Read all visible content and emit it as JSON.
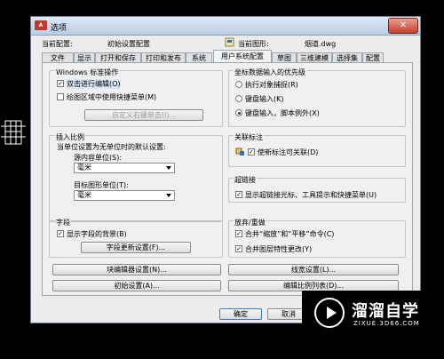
{
  "window": {
    "title": "选项",
    "app_icon_text": "A"
  },
  "header": {
    "current_profile_label": "当前配置:",
    "current_profile_value": "初始设置配置",
    "current_drawing_label": "当前图形:",
    "current_drawing_value": "烟道.dwg"
  },
  "tabs": [
    "文件",
    "显示",
    "打开和保存",
    "打印和发布",
    "系统",
    "用户系统配置",
    "草图",
    "三维建模",
    "选择集",
    "配置"
  ],
  "windows_group": {
    "title": "Windows 标准操作",
    "double_click_edit": "双击进行编辑(O)",
    "shortcut_menu": "绘图区域中使用快捷菜单(M)",
    "custom_right_click": "自定义右键单击(I)..."
  },
  "coord_group": {
    "title": "坐标数据输入的优先级",
    "option1": "执行对象捕捉(R)",
    "option2": "键盘输入(K)",
    "option3": "键盘输入，脚本例外(X)"
  },
  "insert_group": {
    "title": "插入比例",
    "desc": "当单位设置为无单位时的默认设置:",
    "source_label": "源内容单位(S):",
    "source_value": "毫米",
    "target_label": "目标图形单位(T):",
    "target_value": "毫米"
  },
  "assoc_group": {
    "title": "关联标注",
    "label": "使新标注可关联(D)"
  },
  "hyperlink_group": {
    "title": "超链接",
    "label": "显示超链接光标、工具提示和快捷菜单(U)"
  },
  "field_group": {
    "title": "字段",
    "show_bg": "显示字段的背景(B)",
    "settings_button": "字段更新设置(F)..."
  },
  "undo_group": {
    "title": "放弃/重做",
    "merge_zoom": "合并“缩放”和“平移”命令(C)",
    "merge_layer": "合并图层特性更改(Y)"
  },
  "buttons": {
    "block_editor": "块编辑器设置(N)...",
    "lineweight": "线宽设置(L)...",
    "initial_setup": "初始设置(A)...",
    "scale_list": "编辑比例列表(D)...",
    "ok": "确定",
    "cancel": "取消"
  },
  "watermark": {
    "name": "溜溜自学",
    "url": "ZIXUE.3D66.COM"
  }
}
